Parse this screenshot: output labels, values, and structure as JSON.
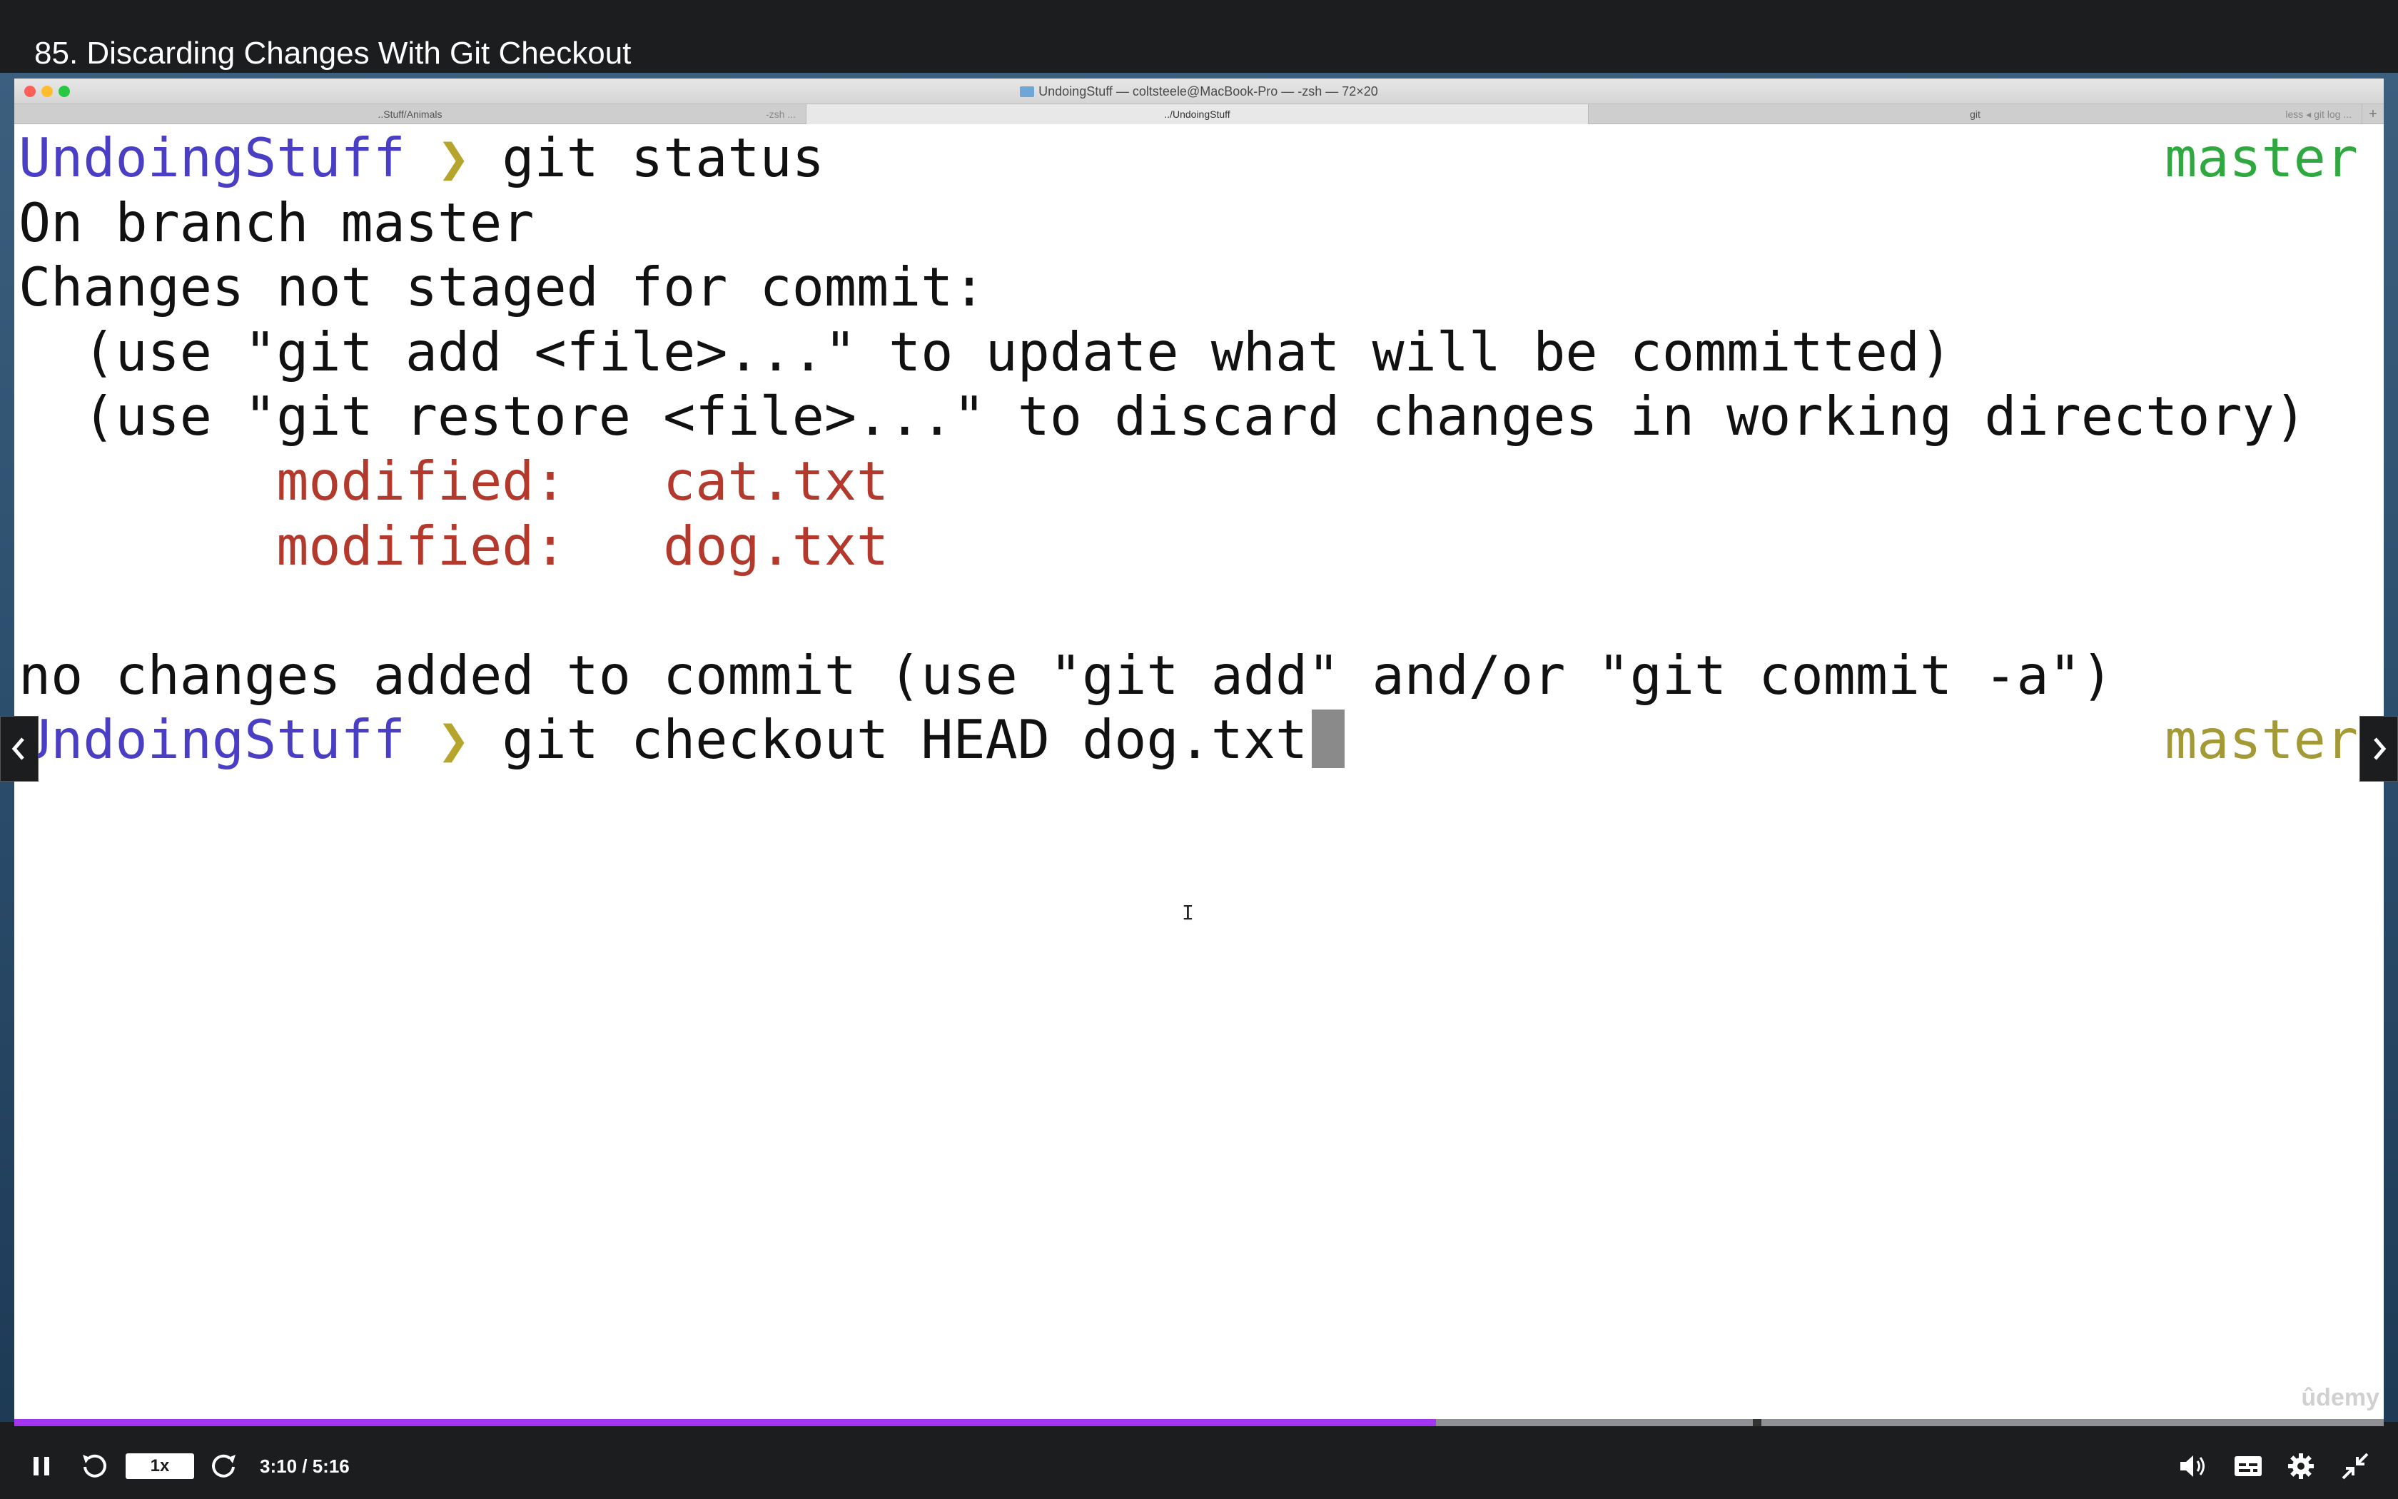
{
  "lecture": {
    "title": "85. Discarding Changes With Git Checkout"
  },
  "window": {
    "title": "UndoingStuff — coltsteele@MacBook-Pro — -zsh — 72×20",
    "tabs": [
      {
        "path": "..Stuff/Animals",
        "proc": "-zsh ...",
        "active": false
      },
      {
        "path": "../UndoingStuff",
        "proc": "",
        "active": true
      },
      {
        "path": "git",
        "proc": "less ◂ git log ...",
        "active": false
      }
    ],
    "add_tab_label": "+"
  },
  "terminal": {
    "prompt_dir": "UndoingStuff",
    "prompt_arrow": "❯",
    "branch": "master",
    "command_1": "git status",
    "output": {
      "line1": "On branch master",
      "line2": "Changes not staged for commit:",
      "line3": "  (use \"git add <file>...\" to update what will be committed)",
      "line4": "  (use \"git restore <file>...\" to discard changes in working directory)",
      "modified_label": "modified:",
      "file1": "cat.txt",
      "file2": "dog.txt",
      "line7": "no changes added to commit (use \"git add\" and/or \"git commit -a\")"
    },
    "command_2": "git checkout HEAD dog.txt",
    "cursor_glyph": "I"
  },
  "watermark": "ûdemy",
  "player": {
    "playback_rate": "1x",
    "time": "3:10 / 5:16",
    "progress": 0.6
  },
  "colors": {
    "accent": "#a435f0",
    "prompt_dir": "#4a3fc4",
    "branch": "#2fa93f",
    "modified": "#b3392c"
  },
  "icons": [
    "chevron-left-icon",
    "chevron-right-icon",
    "pause-icon",
    "rewind-icon",
    "forward-icon",
    "volume-icon",
    "captions-icon",
    "settings-icon",
    "exit-fullscreen-icon",
    "folder-icon"
  ]
}
